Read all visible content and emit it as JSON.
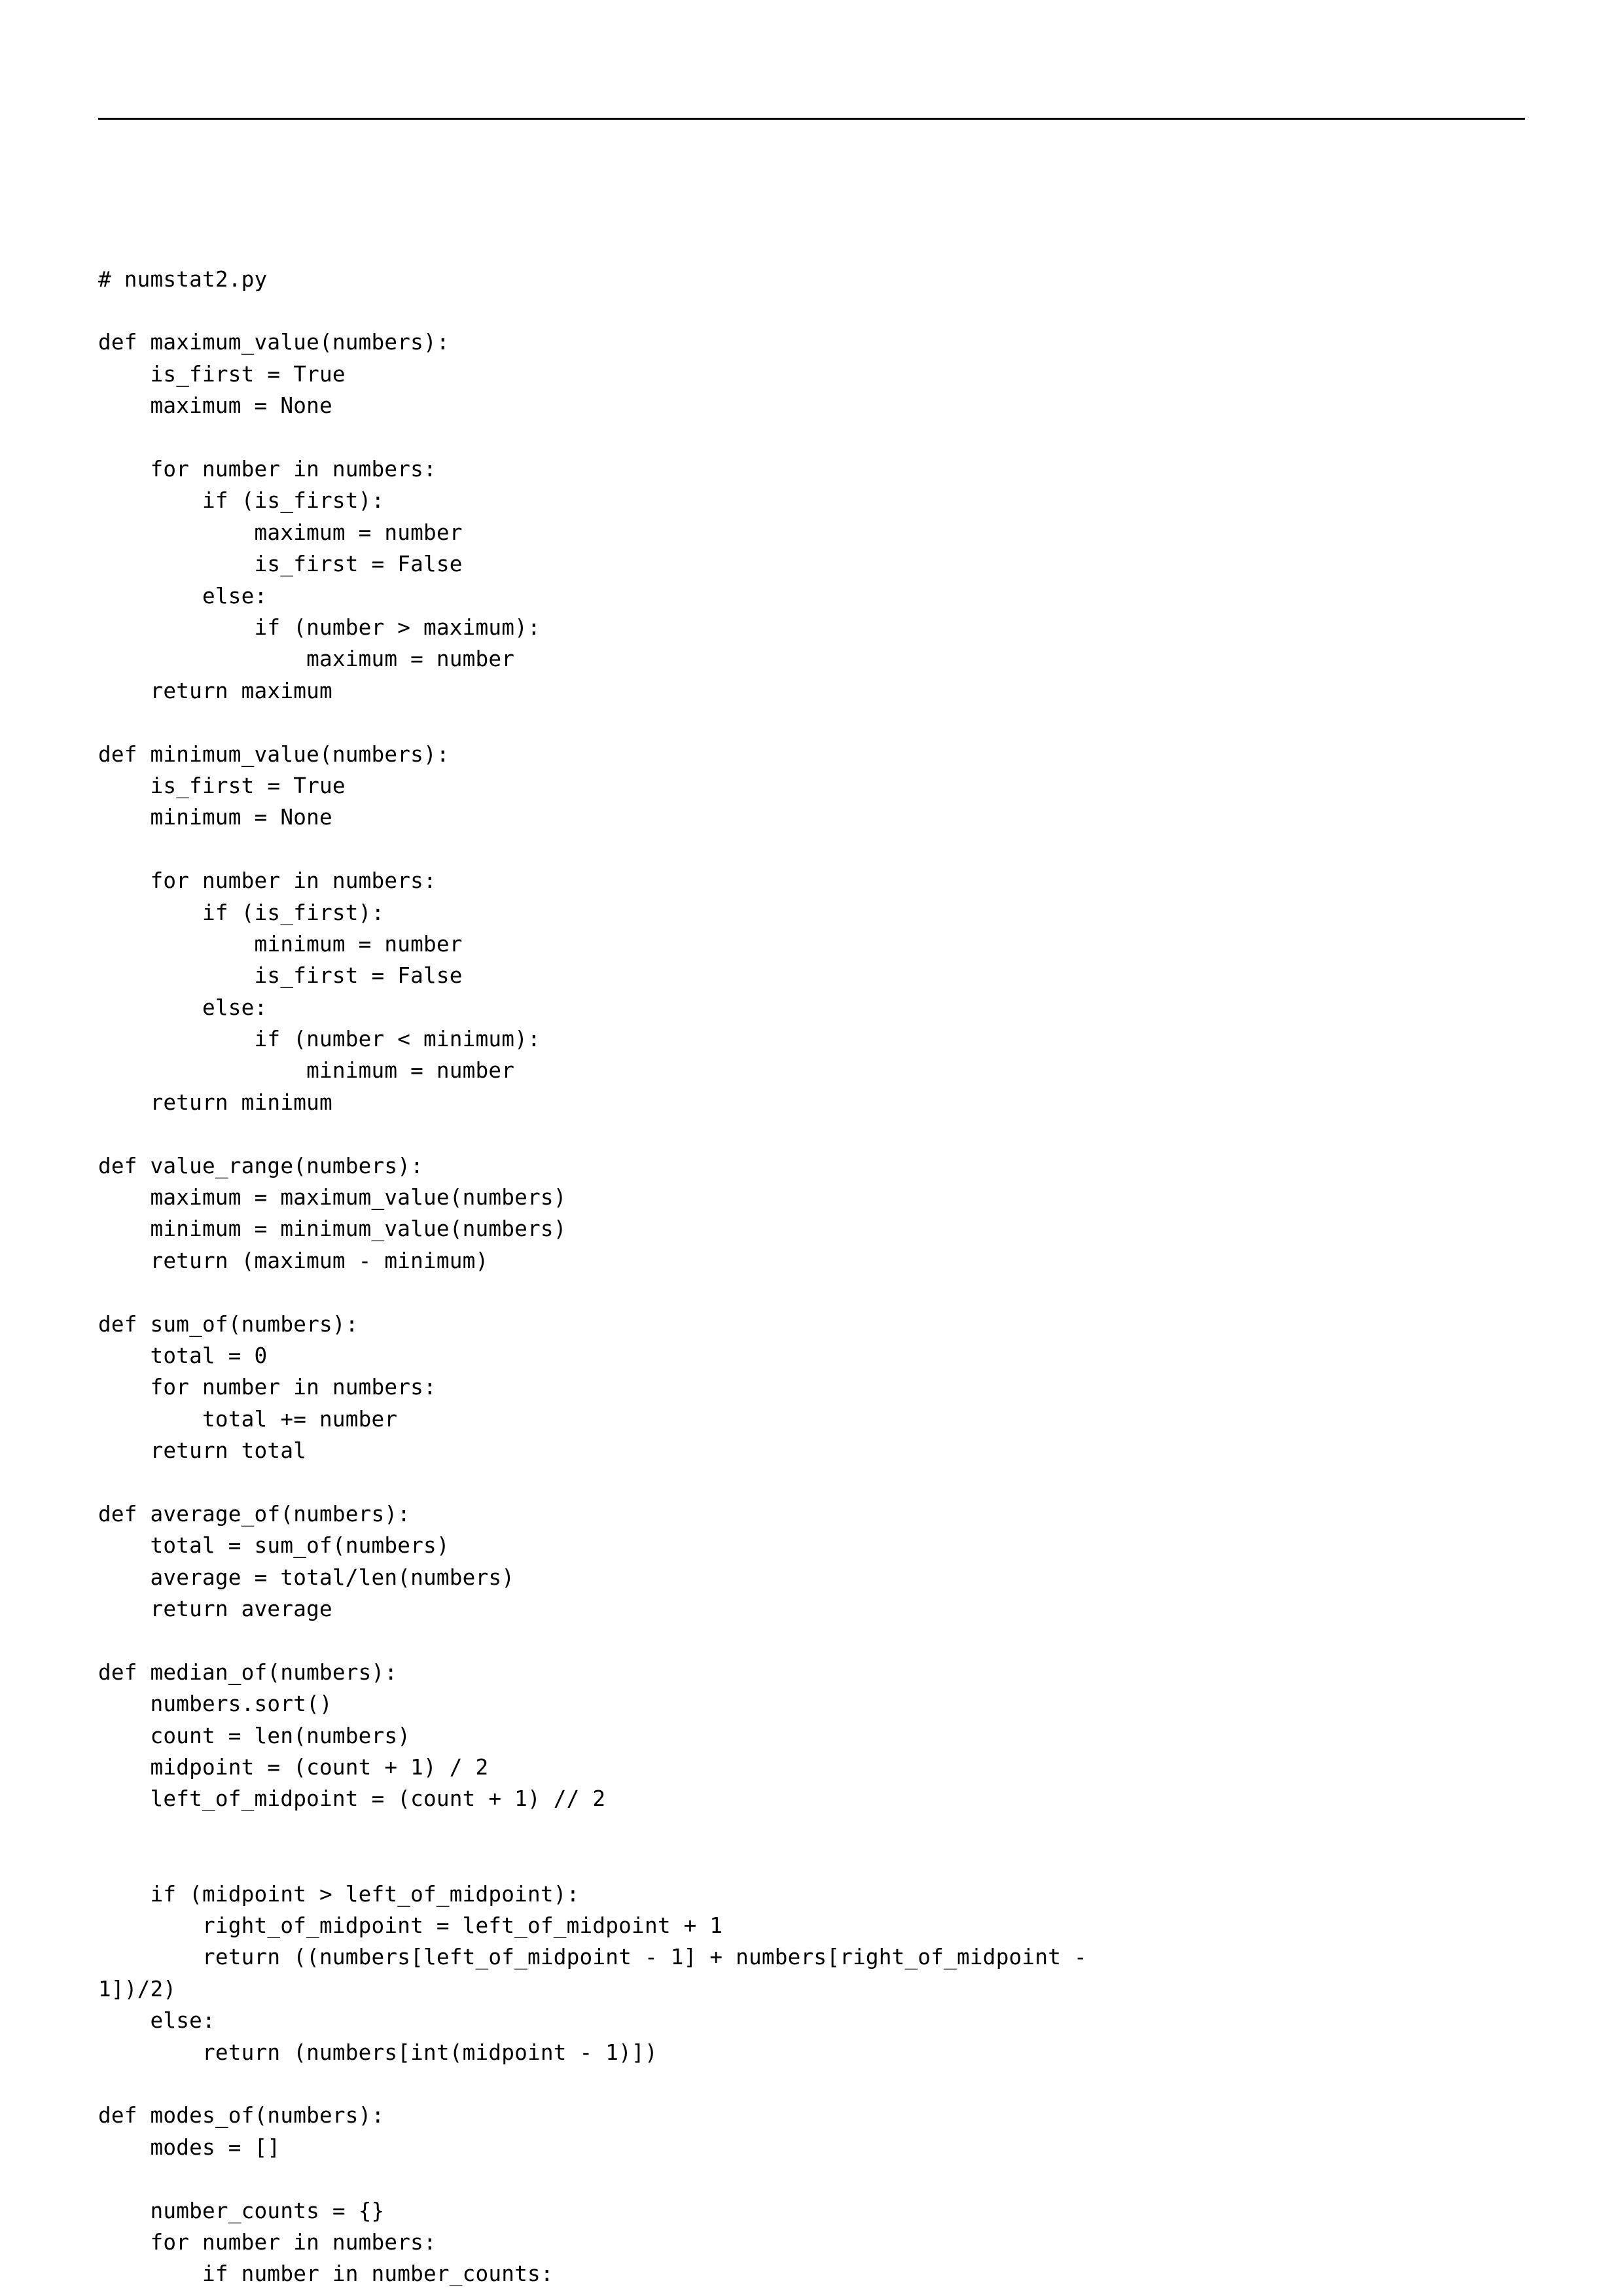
{
  "code": "# numstat2.py\n\ndef maximum_value(numbers):\n    is_first = True\n    maximum = None\n\n    for number in numbers:\n        if (is_first):\n            maximum = number\n            is_first = False\n        else:\n            if (number > maximum):\n                maximum = number\n    return maximum\n\ndef minimum_value(numbers):\n    is_first = True\n    minimum = None\n\n    for number in numbers:\n        if (is_first):\n            minimum = number\n            is_first = False\n        else:\n            if (number < minimum):\n                minimum = number\n    return minimum\n\ndef value_range(numbers):\n    maximum = maximum_value(numbers)\n    minimum = minimum_value(numbers)\n    return (maximum - minimum)\n\ndef sum_of(numbers):\n    total = 0\n    for number in numbers:\n        total += number\n    return total\n\ndef average_of(numbers):\n    total = sum_of(numbers)\n    average = total/len(numbers)\n    return average\n\ndef median_of(numbers):\n    numbers.sort()\n    count = len(numbers)\n    midpoint = (count + 1) / 2\n    left_of_midpoint = (count + 1) // 2\n\n\n    if (midpoint > left_of_midpoint):\n        right_of_midpoint = left_of_midpoint + 1\n        return ((numbers[left_of_midpoint - 1] + numbers[right_of_midpoint - \n1])/2)\n    else:\n        return (numbers[int(midpoint - 1)])\n\ndef modes_of(numbers):\n    modes = []\n\n    number_counts = {}\n    for number in numbers:\n        if number in number_counts:"
}
